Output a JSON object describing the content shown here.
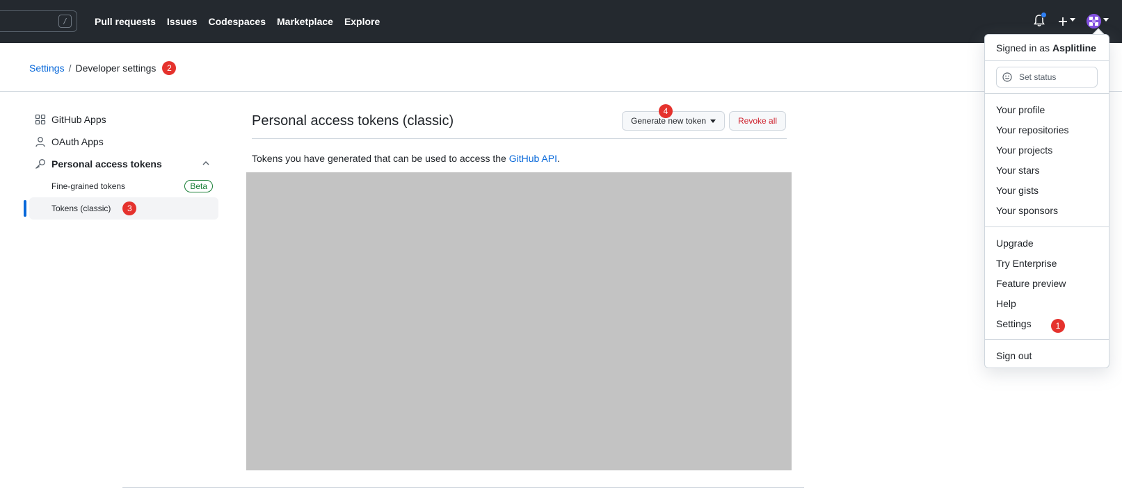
{
  "topnav": {
    "slash_key": "/",
    "links": [
      "Pull requests",
      "Issues",
      "Codespaces",
      "Marketplace",
      "Explore"
    ],
    "plus_icon": "plus-icon",
    "bell_icon": "bell-icon"
  },
  "breadcrumb": {
    "root": "Settings",
    "separator": "/",
    "current": "Developer settings",
    "badge": "2"
  },
  "sidebar": {
    "github_apps": "GitHub Apps",
    "oauth_apps": "OAuth Apps",
    "personal_tokens": "Personal access tokens",
    "fine_grained": "Fine-grained tokens",
    "beta": "Beta",
    "tokens_classic": "Tokens (classic)",
    "tokens_badge": "3"
  },
  "main": {
    "title": "Personal access tokens (classic)",
    "generate_button": "Generate new token",
    "generate_badge": "4",
    "revoke_button": "Revoke all",
    "desc_prefix": "Tokens you have generated that can be used to access the ",
    "desc_link": "GitHub API",
    "desc_suffix": "."
  },
  "dropdown": {
    "signed_prefix": "Signed in as ",
    "username": "Asplitline",
    "set_status": "Set status",
    "items_group1": [
      "Your profile",
      "Your repositories",
      "Your projects",
      "Your stars",
      "Your gists",
      "Your sponsors"
    ],
    "items_group2": [
      "Upgrade",
      "Try Enterprise",
      "Feature preview",
      "Help",
      "Settings"
    ],
    "settings_badge": "1",
    "sign_out": "Sign out"
  },
  "colors": {
    "header_bg": "#24292f",
    "link": "#0969da",
    "badge_red": "#e5322d",
    "danger": "#cf222e",
    "beta_green": "#1a7f37"
  }
}
